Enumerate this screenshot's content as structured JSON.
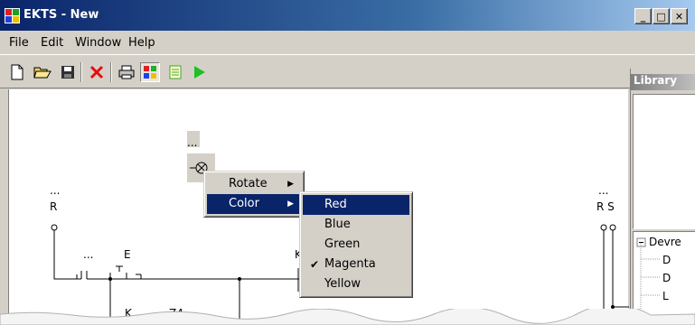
{
  "window": {
    "title": "EKTS - New"
  },
  "window_buttons": {
    "minimize": "_",
    "maximize": "□",
    "close": "✕"
  },
  "menu": [
    {
      "label": "File"
    },
    {
      "label": "Edit"
    },
    {
      "label": "Window"
    },
    {
      "label": "Help"
    }
  ],
  "toolbar": {
    "buttons": [
      "new-file-icon",
      "open-folder-icon",
      "save-icon",
      "delete-icon",
      "print-icon",
      "color-palette-icon",
      "notes-icon",
      "run-icon"
    ]
  },
  "library": {
    "title": "Library",
    "tree_root": "Devre",
    "tree_items": [
      "D",
      "D",
      "L"
    ]
  },
  "canvas": {
    "component_dots": "...",
    "labels": {
      "dots_left": "...",
      "r_left": "R",
      "dots_e": "...",
      "e": "E",
      "k_partial": "K",
      "k_bottom": "K",
      "z4": "Z4",
      "dots_right": "...",
      "rs": "R S"
    }
  },
  "context_menu": {
    "items": [
      {
        "label": "Rotate",
        "submenu": true
      },
      {
        "label": "Color",
        "submenu": true,
        "selected": true
      }
    ]
  },
  "color_submenu": {
    "items": [
      {
        "label": "Red",
        "selected": true
      },
      {
        "label": "Blue"
      },
      {
        "label": "Green"
      },
      {
        "label": "Magenta",
        "checked": true
      },
      {
        "label": "Yellow"
      }
    ]
  },
  "colors": {
    "titlebar": "#0a246a",
    "selection": "#0a246a",
    "chrome": "#d4d0c8"
  }
}
